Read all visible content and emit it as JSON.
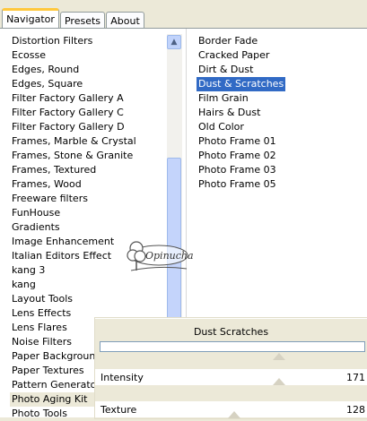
{
  "tabs": [
    {
      "label": "Navigator"
    },
    {
      "label": "Presets"
    },
    {
      "label": "About"
    }
  ],
  "left_list": [
    "Distortion Filters",
    "Ecosse",
    "Edges, Round",
    "Edges, Square",
    "Filter Factory Gallery A",
    "Filter Factory Gallery C",
    "Filter Factory Gallery D",
    "Frames, Marble & Crystal",
    "Frames, Stone & Granite",
    "Frames, Textured",
    "Frames, Wood",
    "Freeware filters",
    "FunHouse",
    "Gradients",
    "Image Enhancement",
    "Italian Editors Effect",
    "kang 3",
    "kang",
    "Layout Tools",
    "Lens Effects",
    "Lens Flares",
    "Noise Filters",
    "Paper Backgrounds",
    "Paper Textures",
    "Pattern Generators",
    "Photo Aging Kit",
    "Photo Tools"
  ],
  "left_selected": "Photo Aging Kit",
  "right_list": [
    "Border Fade",
    "Cracked Paper",
    "Dirt & Dust",
    "Dust & Scratches",
    "Film Grain",
    "Hairs & Dust",
    "Old Color",
    "Photo Frame 01",
    "Photo Frame 02",
    "Photo Frame 03",
    "Photo Frame 05"
  ],
  "right_selected": "Dust & Scratches",
  "dialog": {
    "title": "Dust  Scratches",
    "sliders": [
      {
        "label": "Intensity",
        "value": "171"
      },
      {
        "label": "Texture",
        "value": "128"
      }
    ]
  },
  "watermark": {
    "text": "Opinucha"
  },
  "colors": {
    "selection": "#316ac5",
    "tab_accent": "#ffc83c",
    "face": "#ece9d8"
  }
}
